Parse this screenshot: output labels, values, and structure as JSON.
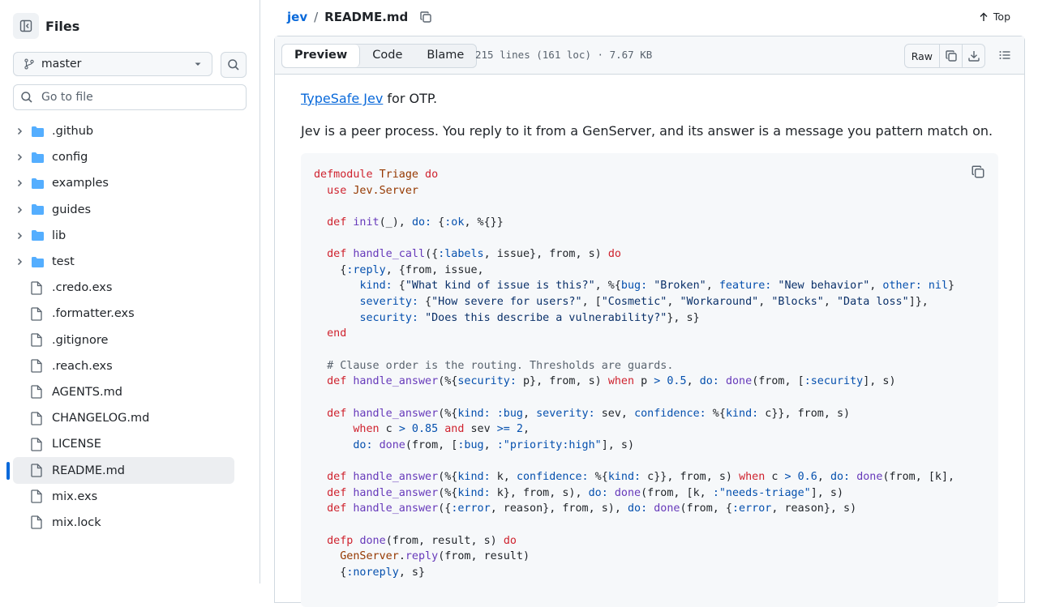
{
  "sidebar": {
    "title": "Files",
    "branch": "master",
    "goto_placeholder": "Go to file",
    "items": [
      {
        "label": ".github",
        "type": "folder"
      },
      {
        "label": "config",
        "type": "folder"
      },
      {
        "label": "examples",
        "type": "folder"
      },
      {
        "label": "guides",
        "type": "folder"
      },
      {
        "label": "lib",
        "type": "folder"
      },
      {
        "label": "test",
        "type": "folder"
      },
      {
        "label": ".credo.exs",
        "type": "file"
      },
      {
        "label": ".formatter.exs",
        "type": "file"
      },
      {
        "label": ".gitignore",
        "type": "file"
      },
      {
        "label": ".reach.exs",
        "type": "file"
      },
      {
        "label": "AGENTS.md",
        "type": "file"
      },
      {
        "label": "CHANGELOG.md",
        "type": "file"
      },
      {
        "label": "LICENSE",
        "type": "file"
      },
      {
        "label": "README.md",
        "type": "file",
        "active": true
      },
      {
        "label": "mix.exs",
        "type": "file"
      },
      {
        "label": "mix.lock",
        "type": "file"
      }
    ]
  },
  "breadcrumb": {
    "repo": "jev",
    "separator": "/",
    "file": "README.md"
  },
  "top_label": "Top",
  "file_header": {
    "tabs": [
      "Preview",
      "Code",
      "Blame"
    ],
    "active_tab": "Preview",
    "info": "215 lines (161 loc) · 7.67 KB",
    "raw_label": "Raw"
  },
  "content": {
    "link_text": "TypeSafe Jev",
    "p1_rest": " for OTP.",
    "p2": "Jev is a peer process. You reply to it from a GenServer, and its answer is a message you pattern match on."
  },
  "colors": {
    "accent": "#0969da",
    "keyword": "#cf222e",
    "module": "#953800",
    "function": "#6639ba",
    "string": "#0a3069",
    "atom": "#0550ae",
    "comment": "#59636e"
  },
  "icons": {
    "sidebar": "sidebar-collapse-icon",
    "branch": "git-branch-icon",
    "search": "search-icon",
    "folder": "folder-icon",
    "file": "file-icon",
    "copy": "copy-icon",
    "download": "download-icon",
    "outline": "list-unordered-icon",
    "top": "arrow-up-icon"
  },
  "code_lines": [
    [
      [
        "k",
        "defmodule "
      ],
      [
        "m",
        "Triage"
      ],
      [
        "k",
        " do"
      ]
    ],
    [
      [
        "t",
        "  "
      ],
      [
        "k",
        "use "
      ],
      [
        "m",
        "Jev.Server"
      ]
    ],
    [],
    [
      [
        "t",
        "  "
      ],
      [
        "k",
        "def "
      ],
      [
        "f",
        "init"
      ],
      [
        "t",
        "(_), "
      ],
      [
        "a",
        "do:"
      ],
      [
        "t",
        " {"
      ],
      [
        "a",
        ":ok"
      ],
      [
        "t",
        ", %{}}"
      ]
    ],
    [],
    [
      [
        "t",
        "  "
      ],
      [
        "k",
        "def "
      ],
      [
        "f",
        "handle_call"
      ],
      [
        "t",
        "({"
      ],
      [
        "a",
        ":labels"
      ],
      [
        "t",
        ", issue}, from, s) "
      ],
      [
        "k",
        "do"
      ]
    ],
    [
      [
        "t",
        "    {"
      ],
      [
        "a",
        ":reply"
      ],
      [
        "t",
        ", {from, issue,"
      ]
    ],
    [
      [
        "t",
        "       "
      ],
      [
        "a",
        "kind:"
      ],
      [
        "t",
        " {"
      ],
      [
        "s",
        "\"What kind of issue is this?\""
      ],
      [
        "t",
        ", %{"
      ],
      [
        "a",
        "bug:"
      ],
      [
        "t",
        " "
      ],
      [
        "s",
        "\"Broken\""
      ],
      [
        "t",
        ", "
      ],
      [
        "a",
        "feature:"
      ],
      [
        "t",
        " "
      ],
      [
        "s",
        "\"New behavior\""
      ],
      [
        "t",
        ", "
      ],
      [
        "a",
        "other:"
      ],
      [
        "t",
        " "
      ],
      [
        "a",
        "nil"
      ],
      [
        "t",
        "}"
      ]
    ],
    [
      [
        "t",
        "       "
      ],
      [
        "a",
        "severity:"
      ],
      [
        "t",
        " {"
      ],
      [
        "s",
        "\"How severe for users?\""
      ],
      [
        "t",
        ", ["
      ],
      [
        "s",
        "\"Cosmetic\""
      ],
      [
        "t",
        ", "
      ],
      [
        "s",
        "\"Workaround\""
      ],
      [
        "t",
        ", "
      ],
      [
        "s",
        "\"Blocks\""
      ],
      [
        "t",
        ", "
      ],
      [
        "s",
        "\"Data loss\""
      ],
      [
        "t",
        "]},"
      ]
    ],
    [
      [
        "t",
        "       "
      ],
      [
        "a",
        "security:"
      ],
      [
        "t",
        " "
      ],
      [
        "s",
        "\"Does this describe a vulnerability?\""
      ],
      [
        "t",
        "}, s}"
      ]
    ],
    [
      [
        "t",
        "  "
      ],
      [
        "k",
        "end"
      ]
    ],
    [],
    [
      [
        "t",
        "  "
      ],
      [
        "c",
        "# Clause order is the routing. Thresholds are guards."
      ]
    ],
    [
      [
        "t",
        "  "
      ],
      [
        "k",
        "def "
      ],
      [
        "f",
        "handle_answer"
      ],
      [
        "t",
        "(%{"
      ],
      [
        "a",
        "security:"
      ],
      [
        "t",
        " p}, from, s) "
      ],
      [
        "k",
        "when"
      ],
      [
        "t",
        " p "
      ],
      [
        "a",
        "> 0.5"
      ],
      [
        "t",
        ", "
      ],
      [
        "a",
        "do:"
      ],
      [
        "t",
        " "
      ],
      [
        "f",
        "done"
      ],
      [
        "t",
        "(from, ["
      ],
      [
        "a",
        ":security"
      ],
      [
        "t",
        "], s)"
      ]
    ],
    [],
    [
      [
        "t",
        "  "
      ],
      [
        "k",
        "def "
      ],
      [
        "f",
        "handle_answer"
      ],
      [
        "t",
        "(%{"
      ],
      [
        "a",
        "kind:"
      ],
      [
        "t",
        " "
      ],
      [
        "a",
        ":bug"
      ],
      [
        "t",
        ", "
      ],
      [
        "a",
        "severity:"
      ],
      [
        "t",
        " sev, "
      ],
      [
        "a",
        "confidence:"
      ],
      [
        "t",
        " %{"
      ],
      [
        "a",
        "kind:"
      ],
      [
        "t",
        " c}}, from, s)"
      ]
    ],
    [
      [
        "t",
        "      "
      ],
      [
        "k",
        "when"
      ],
      [
        "t",
        " c "
      ],
      [
        "a",
        "> 0.85"
      ],
      [
        "t",
        " "
      ],
      [
        "k",
        "and"
      ],
      [
        "t",
        " sev "
      ],
      [
        "a",
        ">= 2"
      ],
      [
        "t",
        ","
      ]
    ],
    [
      [
        "t",
        "      "
      ],
      [
        "a",
        "do:"
      ],
      [
        "t",
        " "
      ],
      [
        "f",
        "done"
      ],
      [
        "t",
        "(from, ["
      ],
      [
        "a",
        ":bug"
      ],
      [
        "t",
        ", "
      ],
      [
        "a",
        ":\"priority:high\""
      ],
      [
        "t",
        "], s)"
      ]
    ],
    [],
    [
      [
        "t",
        "  "
      ],
      [
        "k",
        "def "
      ],
      [
        "f",
        "handle_answer"
      ],
      [
        "t",
        "(%{"
      ],
      [
        "a",
        "kind:"
      ],
      [
        "t",
        " k, "
      ],
      [
        "a",
        "confidence:"
      ],
      [
        "t",
        " %{"
      ],
      [
        "a",
        "kind:"
      ],
      [
        "t",
        " c}}, from, s) "
      ],
      [
        "k",
        "when"
      ],
      [
        "t",
        " c "
      ],
      [
        "a",
        "> 0.6"
      ],
      [
        "t",
        ", "
      ],
      [
        "a",
        "do:"
      ],
      [
        "t",
        " "
      ],
      [
        "f",
        "done"
      ],
      [
        "t",
        "(from, [k],"
      ]
    ],
    [
      [
        "t",
        "  "
      ],
      [
        "k",
        "def "
      ],
      [
        "f",
        "handle_answer"
      ],
      [
        "t",
        "(%{"
      ],
      [
        "a",
        "kind:"
      ],
      [
        "t",
        " k}, from, s), "
      ],
      [
        "a",
        "do:"
      ],
      [
        "t",
        " "
      ],
      [
        "f",
        "done"
      ],
      [
        "t",
        "(from, [k, "
      ],
      [
        "a",
        ":\"needs-triage\""
      ],
      [
        "t",
        "], s)"
      ]
    ],
    [
      [
        "t",
        "  "
      ],
      [
        "k",
        "def "
      ],
      [
        "f",
        "handle_answer"
      ],
      [
        "t",
        "({"
      ],
      [
        "a",
        ":error"
      ],
      [
        "t",
        ", reason}, from, s), "
      ],
      [
        "a",
        "do:"
      ],
      [
        "t",
        " "
      ],
      [
        "f",
        "done"
      ],
      [
        "t",
        "(from, {"
      ],
      [
        "a",
        ":error"
      ],
      [
        "t",
        ", reason}, s)"
      ]
    ],
    [],
    [
      [
        "t",
        "  "
      ],
      [
        "k",
        "defp "
      ],
      [
        "f",
        "done"
      ],
      [
        "t",
        "(from, result, s) "
      ],
      [
        "k",
        "do"
      ]
    ],
    [
      [
        "t",
        "    "
      ],
      [
        "m",
        "GenServer"
      ],
      [
        "t",
        "."
      ],
      [
        "f",
        "reply"
      ],
      [
        "t",
        "(from, result)"
      ]
    ],
    [
      [
        "t",
        "    {"
      ],
      [
        "a",
        ":noreply"
      ],
      [
        "t",
        ", s}"
      ]
    ]
  ]
}
